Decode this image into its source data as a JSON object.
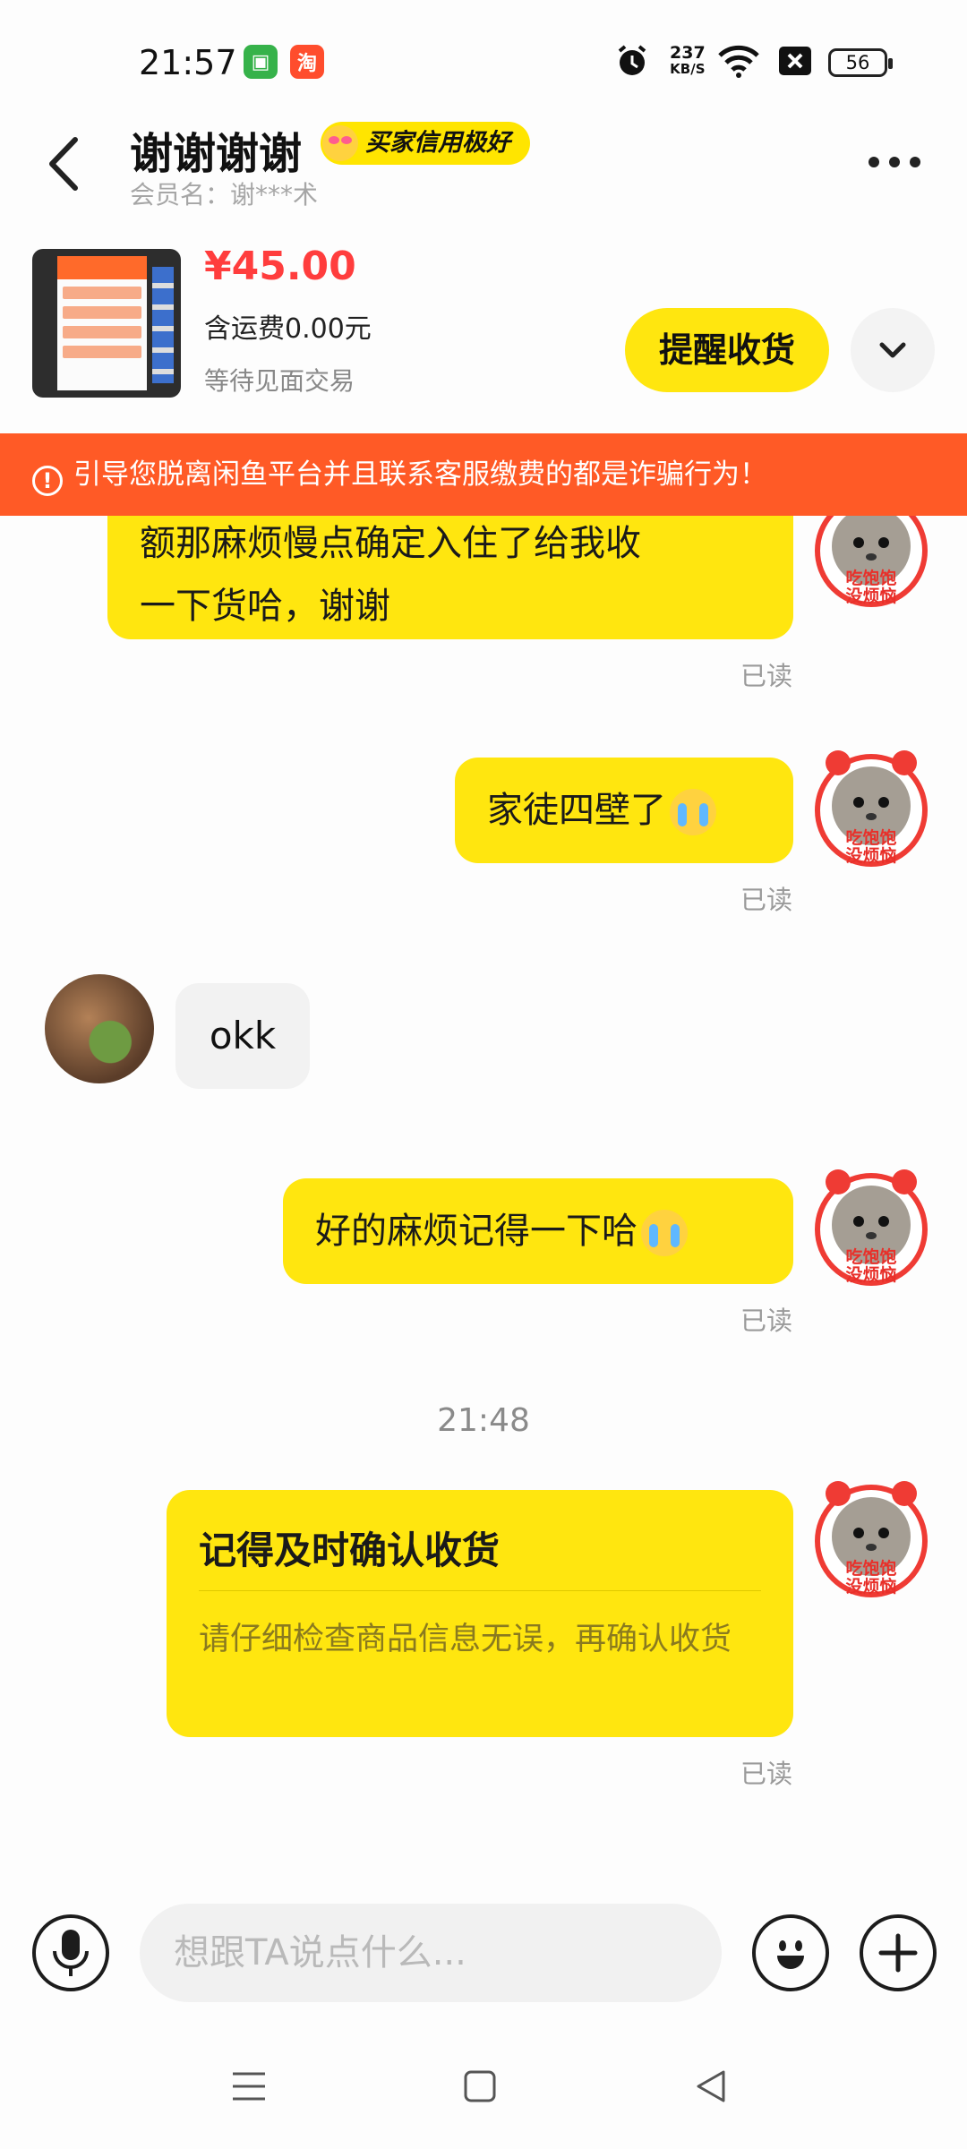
{
  "status_bar": {
    "time": "21:57",
    "network_speed_value": "237",
    "network_speed_unit": "KB/S",
    "battery": "56",
    "icons": [
      "app-green-icon",
      "taobao-icon",
      "alarm-icon",
      "wifi-icon",
      "close-box-icon",
      "battery-icon"
    ]
  },
  "header": {
    "title": "谢谢谢谢",
    "badge": "买家信用极好",
    "member_label": "会员名：谢***术"
  },
  "order": {
    "price": "¥45.00",
    "shipping": "含运费0.00元",
    "status": "等待见面交易",
    "remind_button": "提醒收货"
  },
  "warning": {
    "text": "引导您脱离闲鱼平台并且联系客服缴费的都是诈骗行为！"
  },
  "messages": {
    "m1": {
      "line1": "额那麻烦慢点确定入住了给我收",
      "line2": "一下货哈，谢谢",
      "status": "已读"
    },
    "m2": {
      "text": "家徒四壁了",
      "status": "已读"
    },
    "m3": {
      "text": "okk"
    },
    "m4": {
      "text": "好的麻烦记得一下哈",
      "status": "已读"
    },
    "timestamp": "21:48",
    "card": {
      "title": "记得及时确认收货",
      "body": "请仔细检查商品信息无误，再确认收货",
      "status": "已读"
    }
  },
  "avatar_text": {
    "line1": "吃饱饱",
    "line2": "没烦恼"
  },
  "input": {
    "placeholder": "想跟TA说点什么..."
  },
  "colors": {
    "accent_yellow": "#ffe60f",
    "warning_orange": "#ff5a26",
    "price_red": "#ff3d3d"
  }
}
